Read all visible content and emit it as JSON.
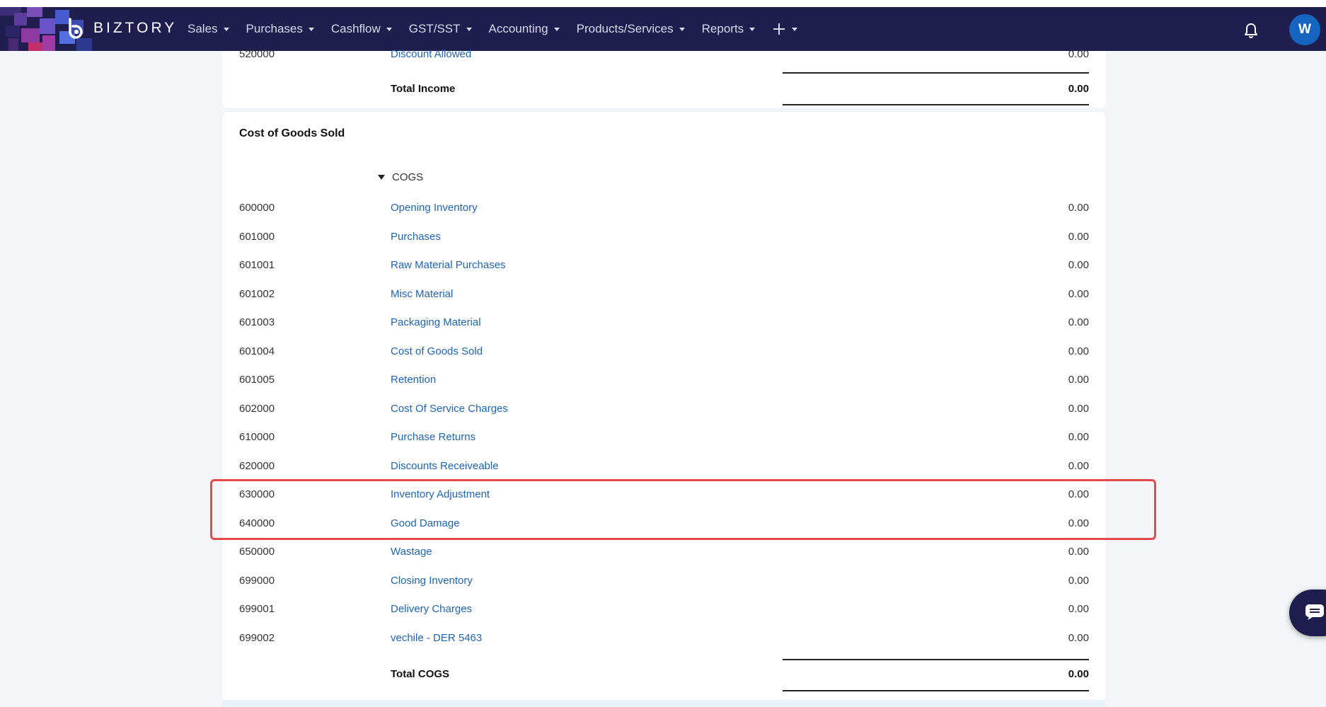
{
  "app": {
    "brand": "BIZTORY",
    "avatar_initial": "W",
    "colors": {
      "navbar": "#201d4f",
      "link": "#1e63b4",
      "highlight": "#e24a4a",
      "avatar": "#1565c0"
    }
  },
  "nav": {
    "items": [
      {
        "label": "Sales"
      },
      {
        "label": "Purchases"
      },
      {
        "label": "Cashflow"
      },
      {
        "label": "GST/SST"
      },
      {
        "label": "Accounting"
      },
      {
        "label": "Products/Services"
      },
      {
        "label": "Reports"
      }
    ],
    "add_icon": "plus-icon",
    "notifications_icon": "bell-icon"
  },
  "income": {
    "partial_row": {
      "code": "520000",
      "name": "Discount Allowed",
      "amount": "0.00"
    },
    "total_label": "Total Income",
    "total_amount": "0.00"
  },
  "cogs": {
    "section_title": "Cost of Goods Sold",
    "group_label": "COGS",
    "rows": [
      {
        "code": "600000",
        "name": "Opening Inventory",
        "amount": "0.00"
      },
      {
        "code": "601000",
        "name": "Purchases",
        "amount": "0.00"
      },
      {
        "code": "601001",
        "name": "Raw Material Purchases",
        "amount": "0.00"
      },
      {
        "code": "601002",
        "name": "Misc Material",
        "amount": "0.00"
      },
      {
        "code": "601003",
        "name": "Packaging Material",
        "amount": "0.00"
      },
      {
        "code": "601004",
        "name": "Cost of Goods Sold",
        "amount": "0.00"
      },
      {
        "code": "601005",
        "name": "Retention",
        "amount": "0.00"
      },
      {
        "code": "602000",
        "name": "Cost Of Service Charges",
        "amount": "0.00"
      },
      {
        "code": "610000",
        "name": "Purchase Returns",
        "amount": "0.00"
      },
      {
        "code": "620000",
        "name": "Discounts Receiveable",
        "amount": "0.00"
      },
      {
        "code": "630000",
        "name": "Inventory Adjustment",
        "amount": "0.00"
      },
      {
        "code": "640000",
        "name": "Good Damage",
        "amount": "0.00"
      },
      {
        "code": "650000",
        "name": "Wastage",
        "amount": "0.00"
      },
      {
        "code": "699000",
        "name": "Closing Inventory",
        "amount": "0.00"
      },
      {
        "code": "699001",
        "name": "Delivery Charges",
        "amount": "0.00"
      },
      {
        "code": "699002",
        "name": "vechile - DER 5463",
        "amount": "0.00"
      }
    ],
    "total_label": "Total COGS",
    "total_amount": "0.00"
  },
  "chat": {
    "icon": "chat-icon"
  }
}
